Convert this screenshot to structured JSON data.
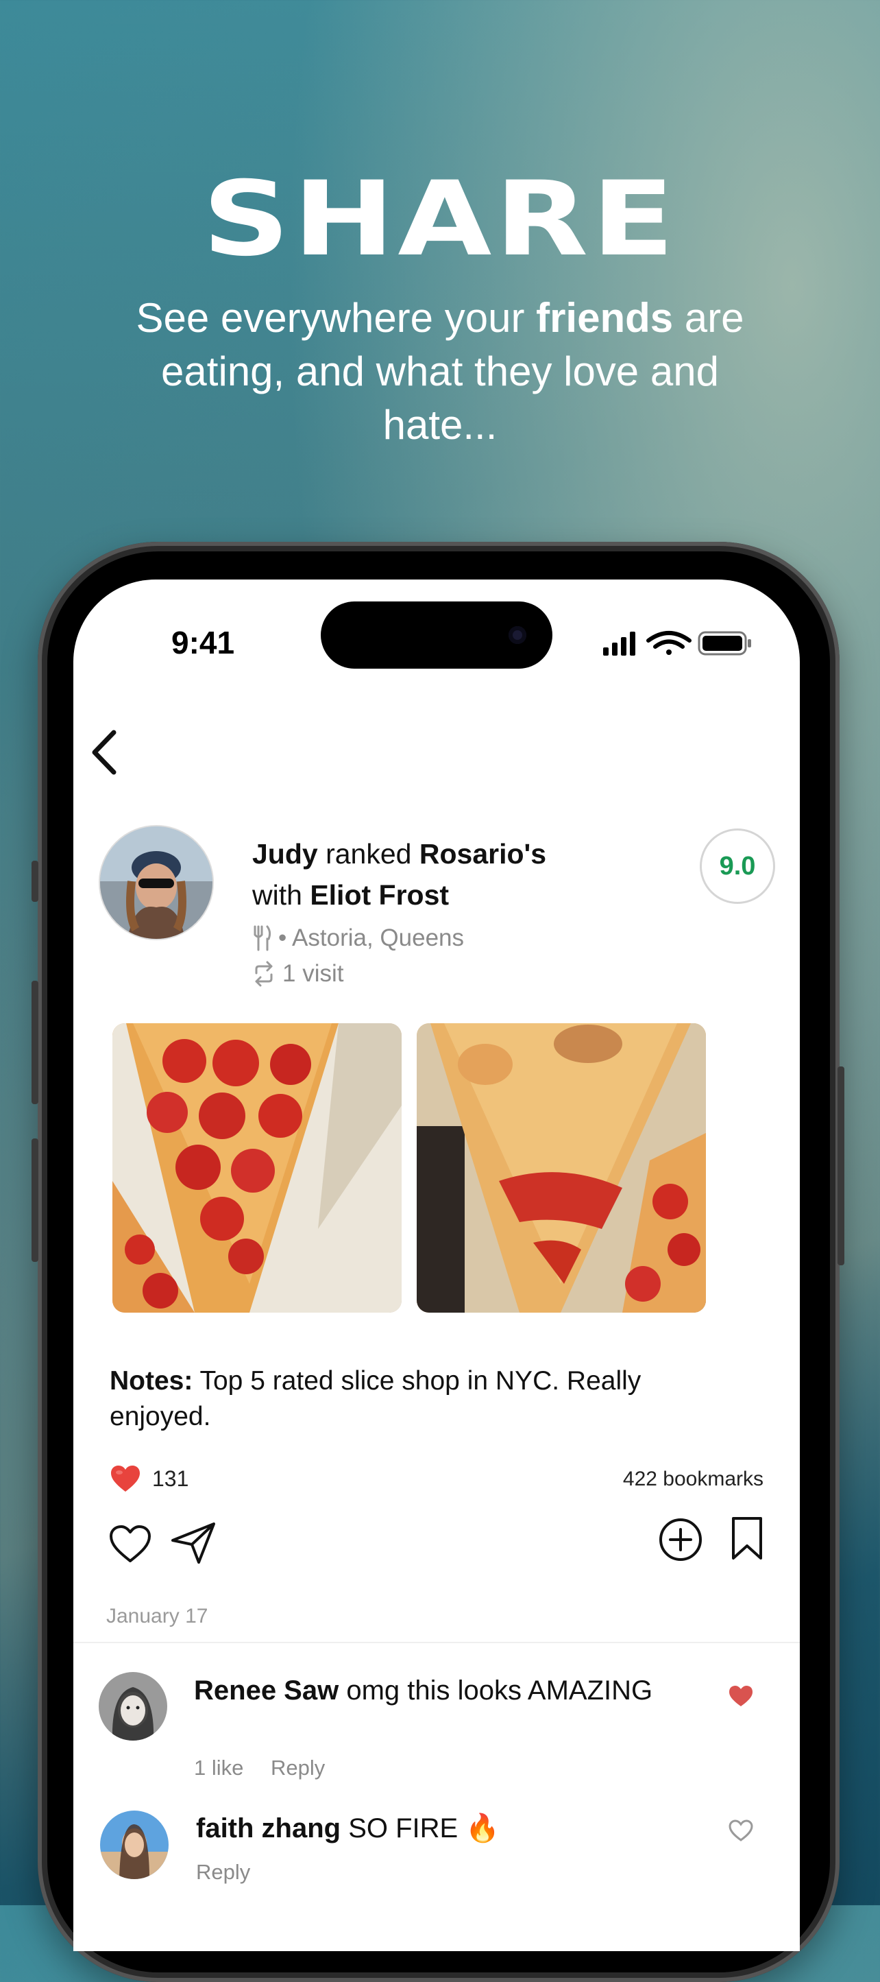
{
  "promo": {
    "headline": "SHARE",
    "sub_part1": "See everywhere your ",
    "sub_bold": "friends",
    "sub_part2": " are eating, and what they love and hate..."
  },
  "status_bar": {
    "time": "9:41"
  },
  "post": {
    "user": "Judy",
    "ranked_text": " ranked ",
    "restaurant": "Rosario's",
    "with_text": "with ",
    "companion": "Eliot Frost",
    "location": "• Astoria, Queens",
    "visits": "1 visit",
    "score": "9.0",
    "notes_label": "Notes:",
    "notes_text": " Top 5 rated slice shop in NYC. Really enjoyed.",
    "like_count": "131",
    "bookmarks": "422 bookmarks",
    "date": "January 17"
  },
  "comments": [
    {
      "name": "Renee Saw",
      "text": " omg this looks AMAZING",
      "likes": "1 like",
      "reply": "Reply",
      "liked": true
    },
    {
      "name": "faith zhang",
      "text": " SO FIRE 🔥",
      "reply": "Reply",
      "liked": false
    }
  ],
  "colors": {
    "score_green": "#1a9a55",
    "heart_red": "#d9534f",
    "like_red": "#e8433d"
  }
}
